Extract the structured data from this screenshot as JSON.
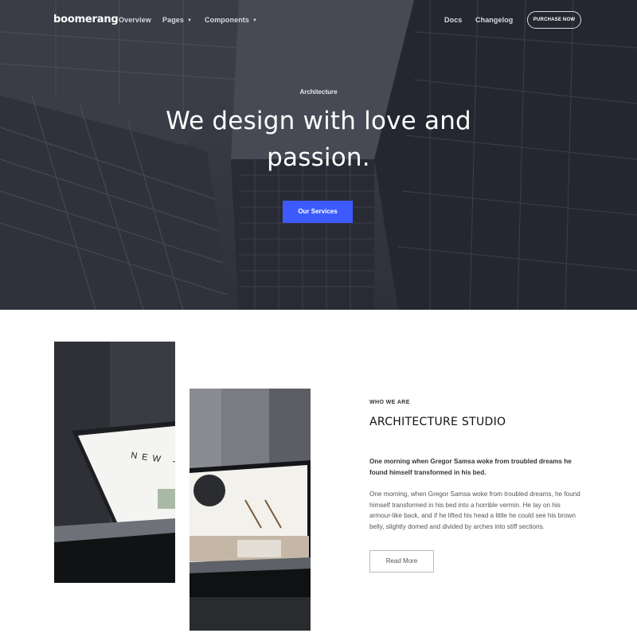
{
  "nav": {
    "logo": "boomerang",
    "links": [
      "Overview",
      "Pages",
      "Components"
    ],
    "right_links": [
      "Docs",
      "Changelog"
    ],
    "purchase_label": "PURCHASE NOW"
  },
  "hero": {
    "eyebrow": "Architecture",
    "headline": "We design with love and passion.",
    "cta_label": "Our Services",
    "cta_color": "#3d5afe"
  },
  "about": {
    "kicker": "WHO WE ARE",
    "title": "ARCHITECTURE STUDIO",
    "lead": "One morning when Gregor Samsa woke from troubled dreams he found himself transformed in his bed.",
    "body": "One morning, when Gregor Samsa woke from troubled dreams, he found himself transformed in his bed into a horrible vermin. He lay on his armour-like back, and if he lifted his head a little he could see his brown belly, slightly domed and divided by arches into stiff sections.",
    "read_more_label": "Read More",
    "laptop_left_text": "NEW - IN"
  }
}
